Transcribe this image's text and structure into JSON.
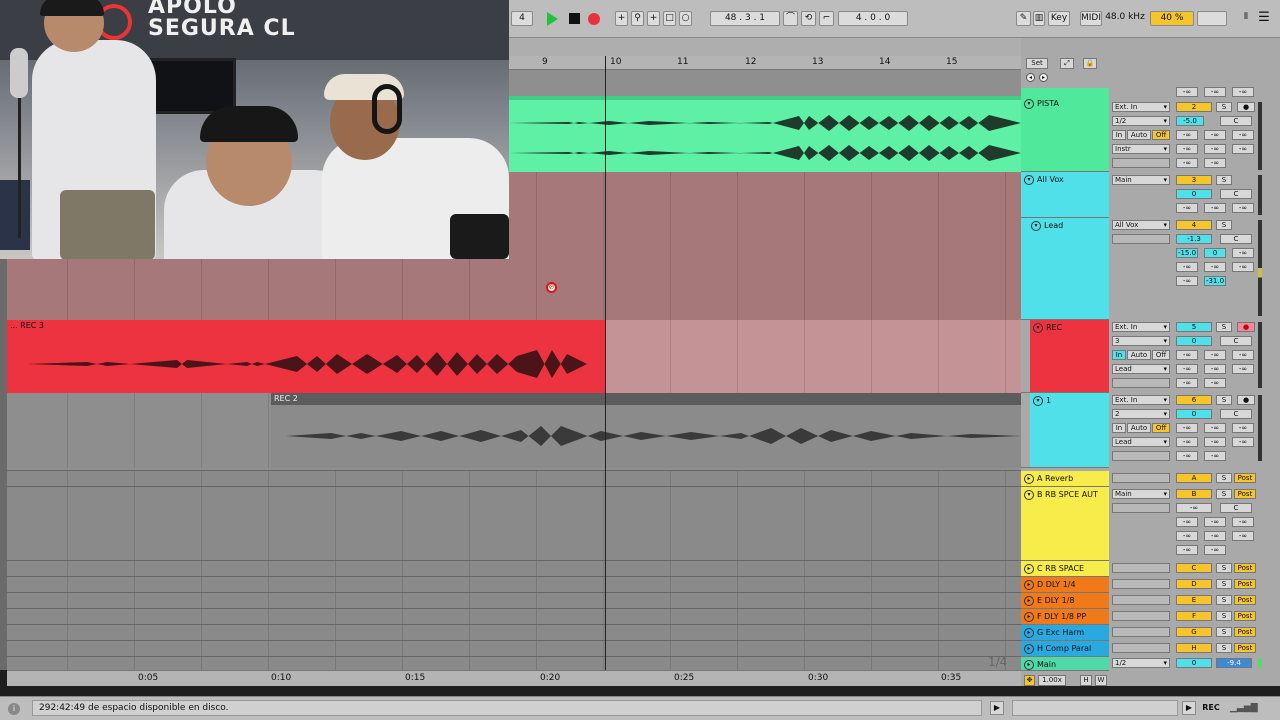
{
  "transport": {
    "left_value": "4",
    "position": "48 . 3 . 1",
    "loop_length": "4 . 0 . 0",
    "key_label": "Key",
    "midi_label": "MIDI",
    "sample_rate": "48.0 kHz",
    "cpu": "40 %"
  },
  "webcam": {
    "sign_line1": "APOLO",
    "sign_line2": "SEGURA CL"
  },
  "ruler": {
    "bars": [
      "9",
      "10",
      "11",
      "12",
      "13",
      "14",
      "15"
    ]
  },
  "set_panel": {
    "set_label": "Set"
  },
  "arrangement": {
    "clip_rec3": "... REC 3",
    "clip_rec2": "REC 2",
    "page_indicator": "1/4"
  },
  "timeline": {
    "times": [
      "0:05",
      "0:10",
      "0:15",
      "0:20",
      "0:25",
      "0:30",
      "0:35"
    ]
  },
  "tracks": [
    {
      "name": "PISTA",
      "input": "Ext. In",
      "channel": "1/2",
      "monitor": [
        "In",
        "Auto",
        "Off"
      ],
      "output": "Instr",
      "number": "2",
      "volume": "-5.0",
      "pan": "C",
      "color": "#50e89a"
    },
    {
      "name": "All Vox",
      "output": "Main",
      "number": "3",
      "volume": "0",
      "pan": "C",
      "color": "#4fe0ea"
    },
    {
      "name": "Lead",
      "output": "All Vox",
      "number": "4",
      "volume": "-1.3",
      "pan": "C",
      "extra": [
        "-15.0",
        "0",
        "-31.0"
      ],
      "color": "#4fe0ea"
    },
    {
      "name": "REC",
      "input": "Ext. In",
      "channel": "3",
      "monitor": [
        "In",
        "Auto",
        "Off"
      ],
      "output": "Lead",
      "number": "5",
      "volume": "0",
      "pan": "C",
      "color": "#ee3340"
    },
    {
      "name": "1",
      "input": "Ext. In",
      "channel": "2",
      "monitor": [
        "In",
        "Auto",
        "Off"
      ],
      "output": "Lead",
      "number": "6",
      "volume": "0",
      "pan": "C",
      "color": "#4fe0ea"
    }
  ],
  "returns": [
    {
      "name": "A Reverb",
      "letter": "A",
      "color": "#f7ec4a"
    },
    {
      "name": "B RB SPCE AUT",
      "letter": "B",
      "output": "Main",
      "color": "#f7ec4a"
    },
    {
      "name": "C RB SPACE",
      "letter": "C",
      "color": "#f7ec4a"
    },
    {
      "name": "D DLY 1/4",
      "letter": "D",
      "color": "#f07a1a"
    },
    {
      "name": "E DLY 1/8",
      "letter": "E",
      "color": "#f07a1a"
    },
    {
      "name": "F DLY 1/8 PP",
      "letter": "F",
      "color": "#f07a1a"
    },
    {
      "name": "G Exc Harm",
      "letter": "G",
      "color": "#2aa8e0"
    },
    {
      "name": "H Comp Paral",
      "letter": "H",
      "color": "#2aa8e0"
    }
  ],
  "master": {
    "name": "Main",
    "channel": "1/2",
    "number": "0",
    "volume": "-9.4",
    "zoom": "1.00x",
    "h": "H",
    "w": "W"
  },
  "labels": {
    "solo": "S",
    "post": "Post",
    "center": "C",
    "neg_inf": "-∞"
  },
  "status": {
    "message": "292:42:49 de espacio disponible en disco.",
    "rec_label": "REC"
  }
}
